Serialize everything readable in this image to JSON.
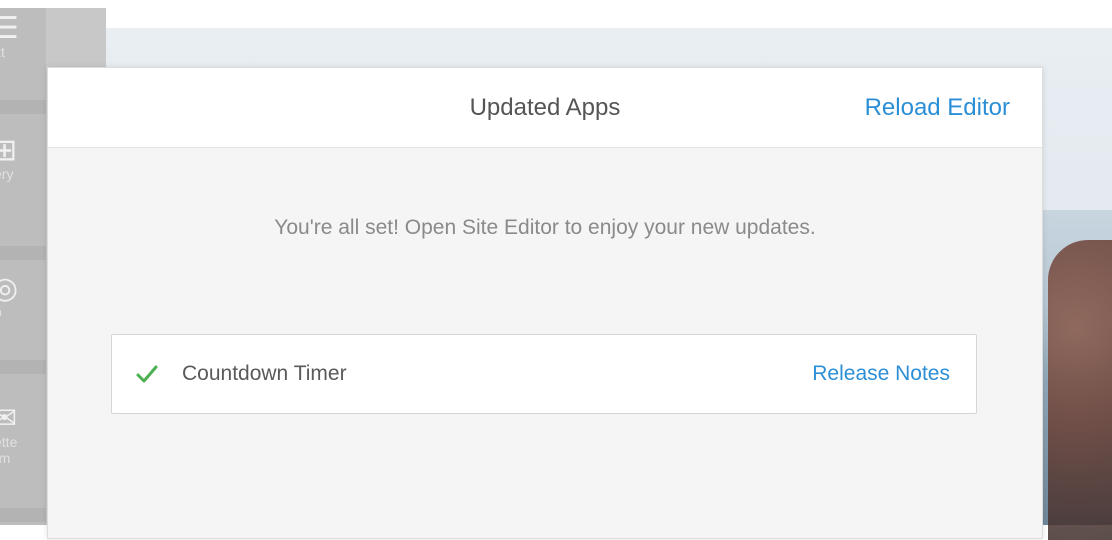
{
  "colors": {
    "link": "#2c8fd6",
    "check": "#4caf50",
    "title_text": "#555555",
    "message_text": "#8a8a8a"
  },
  "tool_rail": {
    "items": [
      {
        "icon": "text-icon",
        "label": "xt"
      },
      {
        "icon": "gallery-icon",
        "label": "ery"
      },
      {
        "icon": "map-icon",
        "label": "p"
      },
      {
        "icon": "newsletter-icon",
        "label": "ette",
        "label2": "rm"
      }
    ]
  },
  "modal": {
    "title": "Updated Apps",
    "reload_label": "Reload Editor",
    "message": "You're all set! Open Site Editor to enjoy your new updates.",
    "updates": [
      {
        "status_icon": "check-icon",
        "app_name": "Countdown Timer",
        "link_label": "Release Notes"
      }
    ]
  }
}
